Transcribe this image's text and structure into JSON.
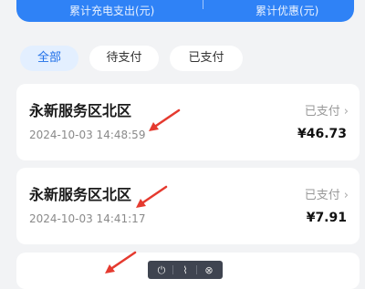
{
  "summary": {
    "charge_spend_label": "累计充电支出(元)",
    "discount_label": "累计优惠(元)"
  },
  "tabs": [
    {
      "label": "全部",
      "active": true
    },
    {
      "label": "待支付",
      "active": false
    },
    {
      "label": "已支付",
      "active": false
    }
  ],
  "orders": [
    {
      "station": "永新服务区北区",
      "time": "2024-10-03 14:48:59",
      "status": "已支付",
      "amount": "¥46.73"
    },
    {
      "station": "永新服务区北区",
      "time": "2024-10-03 14:41:17",
      "status": "已支付",
      "amount": "¥7.91"
    }
  ],
  "colors": {
    "accent": "#2f82f6",
    "active_tab_bg": "#e3efff",
    "annotation_arrow": "#e53a2f"
  },
  "icons": {
    "status_chevron": "chevron-right-icon",
    "toolbar": [
      "power-icon",
      "bookmark-icon",
      "close-circle-icon"
    ]
  }
}
